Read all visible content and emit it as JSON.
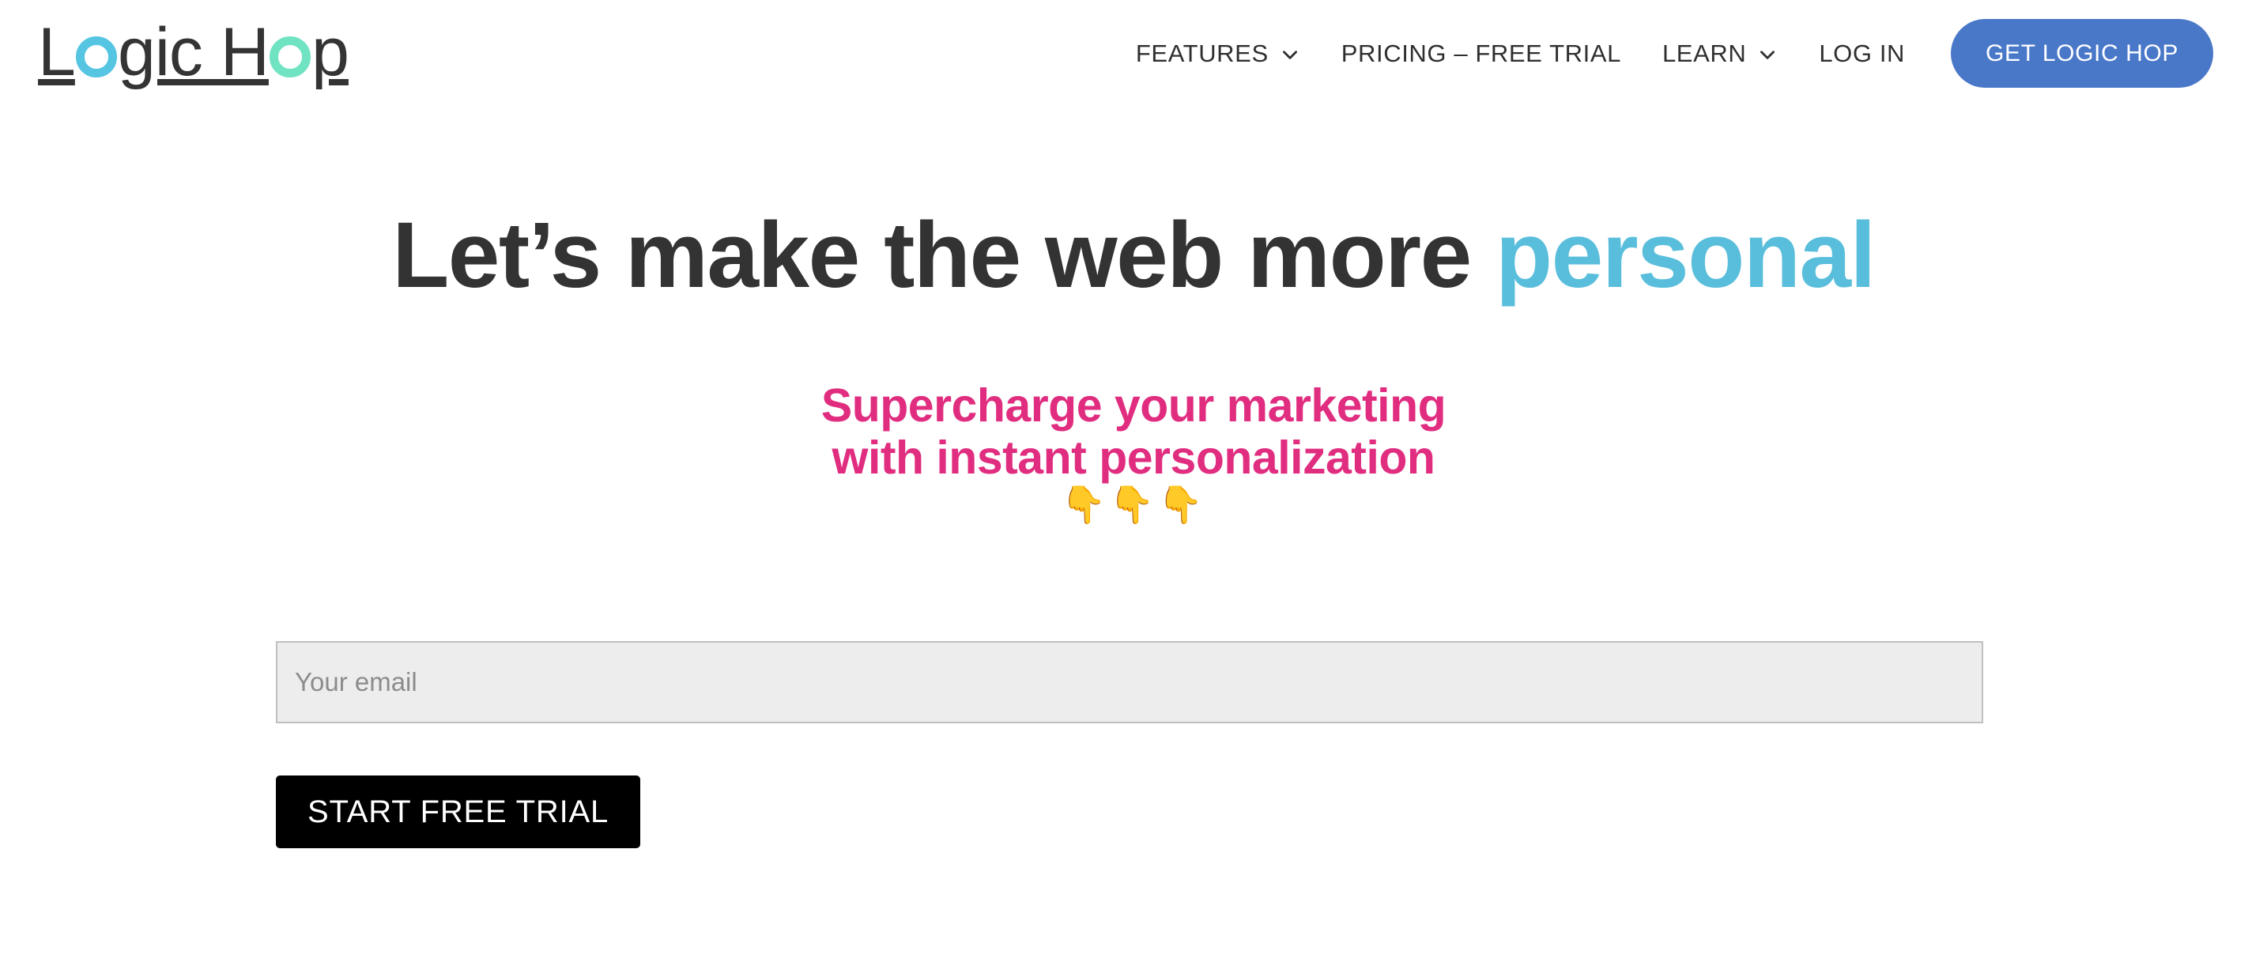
{
  "brand": {
    "name": "Logic Hop",
    "logo_parts": [
      {
        "text": "L",
        "type": "text"
      },
      {
        "text": "o",
        "type": "ring",
        "color": "#56c5e2"
      },
      {
        "text": "gic H",
        "type": "text"
      },
      {
        "text": "o",
        "type": "ring",
        "color": "#70e3c3"
      },
      {
        "text": "p",
        "type": "text"
      }
    ],
    "text_color": "#343434"
  },
  "nav": {
    "items": [
      {
        "label": "FEATURES",
        "has_dropdown": true,
        "icon": "chevron-down-icon"
      },
      {
        "label": "PRICING – FREE TRIAL",
        "has_dropdown": false
      },
      {
        "label": "LEARN",
        "has_dropdown": true,
        "icon": "chevron-down-icon"
      },
      {
        "label": "LOG IN",
        "has_dropdown": false
      }
    ],
    "cta": {
      "label": "GET LOGIC HOP",
      "bg_color": "#4a78c9",
      "text_color": "#ffffff"
    },
    "text_color": "#2f2f2f"
  },
  "hero": {
    "title_plain": "Let’s make the web more ",
    "title_accent": "personal",
    "title_color": "#333333",
    "accent_color": "#59bedc"
  },
  "subhead": {
    "line1": "Supercharge your marketing",
    "line2": "with instant personalization",
    "emoji": "👇👇👇",
    "color": "#e02d80"
  },
  "form": {
    "email_placeholder": "Your email",
    "email_value": "",
    "submit_label": "START FREE TRIAL",
    "submit_bg": "#000000",
    "input_bg": "#ededed",
    "input_border": "#c0c0c0"
  }
}
